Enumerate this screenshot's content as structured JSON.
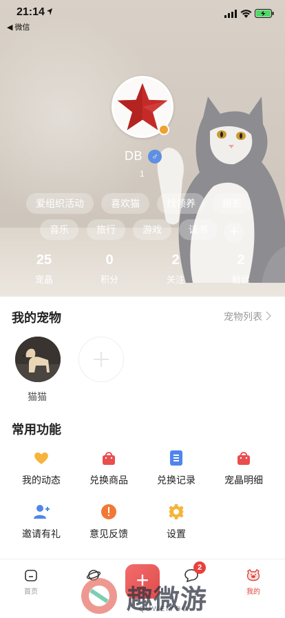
{
  "status_bar": {
    "time": "21:14",
    "back_label": "◀ 微信"
  },
  "profile": {
    "nickname": "DB",
    "gender_symbol": "♂",
    "user_id": "1",
    "tags": [
      "爱组织活动",
      "喜欢猫",
      "找领养",
      "摄影",
      "音乐",
      "旅行",
      "游戏",
      "读书"
    ],
    "add_tag_symbol": "+",
    "stats": [
      {
        "value": "25",
        "label": "宠晶"
      },
      {
        "value": "0",
        "label": "积分"
      },
      {
        "value": "2",
        "label": "关注"
      },
      {
        "value": "2",
        "label": "粉丝"
      }
    ]
  },
  "pets": {
    "title": "我的宠物",
    "list_link": "宠物列表",
    "items": [
      {
        "name": "猫猫"
      }
    ]
  },
  "functions": {
    "title": "常用功能",
    "items": [
      {
        "label": "我的动态",
        "icon": "heart-icon",
        "color": "#f5b43c"
      },
      {
        "label": "兑换商品",
        "icon": "shopping-bag-icon",
        "color": "#ea4d4d"
      },
      {
        "label": "兑换记录",
        "icon": "document-icon",
        "color": "#4f86ec"
      },
      {
        "label": "宠晶明细",
        "icon": "shopping-bag-icon",
        "color": "#ea4d4d"
      },
      {
        "label": "邀请有礼",
        "icon": "add-user-icon",
        "color": "#4f86ec"
      },
      {
        "label": "意见反馈",
        "icon": "exclamation-icon",
        "color": "#f07a35"
      },
      {
        "label": "设置",
        "icon": "gear-icon",
        "color": "#f5b43c"
      }
    ]
  },
  "tabbar": {
    "items": [
      {
        "label": "首页",
        "icon": "home-icon"
      },
      {
        "label": "",
        "icon": "planet-icon"
      },
      {
        "label": "",
        "icon": "add-icon"
      },
      {
        "label": "",
        "icon": "message-icon"
      },
      {
        "label": "我的",
        "icon": "pig-icon",
        "active": true
      }
    ],
    "add_symbol": "+",
    "message_badge": "2",
    "accent_color": "#e0443c"
  },
  "watermark": {
    "text": "趣微游",
    "subtext": "QUWEIYOU"
  }
}
